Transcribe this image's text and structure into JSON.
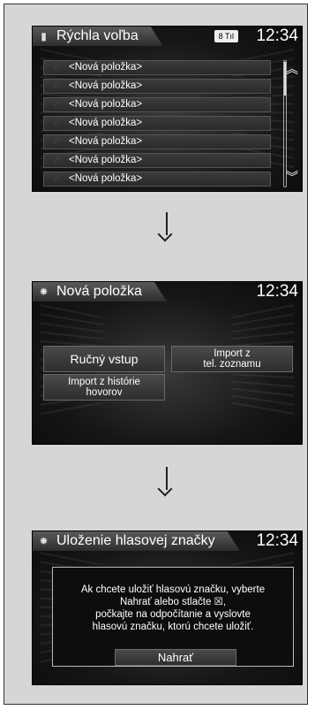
{
  "screen1": {
    "title": "Rýchla voľba",
    "clock": "12:34",
    "signal": "8 Tıl",
    "items": [
      "<Nová položka>",
      "<Nová položka>",
      "<Nová položka>",
      "<Nová položka>",
      "<Nová položka>",
      "<Nová položka>",
      "<Nová položka>"
    ]
  },
  "screen2": {
    "title": "Nová položka",
    "clock": "12:34",
    "buttons": {
      "manual": "Ručný vstup",
      "import_phone_1": "Import z",
      "import_phone_2": "tel. zoznamu",
      "import_history_1": "Import z histórie",
      "import_history_2": "hovorov"
    }
  },
  "screen3": {
    "title": "Uloženie hlasovej značky",
    "clock": "12:34",
    "message": [
      "Ak chcete uložiť hlasovú značku, vyberte",
      "Nahrať alebo stlačte ☒,",
      "počkajte na odpočítanie a vyslovte",
      "hlasovú značku, ktorú chcete uložiť."
    ],
    "record_button": "Nahrať"
  }
}
